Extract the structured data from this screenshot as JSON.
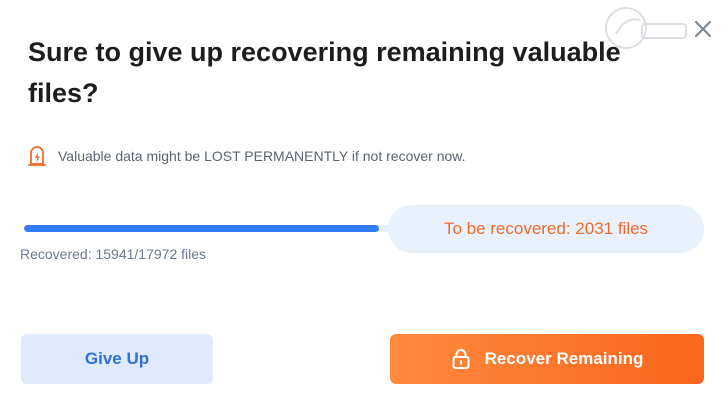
{
  "dialog": {
    "title": "Sure to give up recovering remaining valuable files?",
    "warning": "Valuable data might be LOST PERMANENTLY if not recover now.",
    "warning_icon": "power-bolt-icon",
    "progress": {
      "recovered_label": "Recovered: 15941/17972 files",
      "fraction": 0.887
    },
    "remaining_label": "To be recovered: 2031 files",
    "buttons": {
      "give_up": "Give Up",
      "recover_remaining": "Recover Remaining"
    },
    "close_icon": "close-icon",
    "lock_icon": "lock-icon"
  },
  "colors": {
    "accent_blue": "#2f7cf6",
    "accent_orange": "#f9651c",
    "warning_orange": "#f06a2a"
  }
}
